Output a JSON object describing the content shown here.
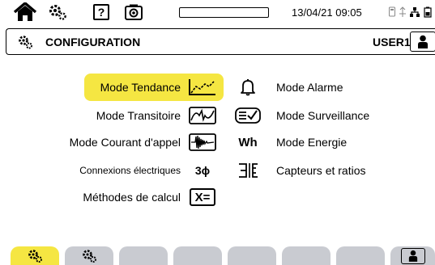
{
  "status_bar": {
    "datetime": "13/04/21 09:05",
    "icons": [
      "home-icon",
      "settings-gear-icon",
      "help-icon",
      "camera-icon",
      "progress-bar",
      "usb-icon",
      "network-icon",
      "battery-icon"
    ]
  },
  "title_bar": {
    "title": "CONFIGURATION",
    "user": "USER1",
    "icon": "configuration-gear-icon",
    "user_icon": "user-icon"
  },
  "menu": {
    "left": [
      {
        "label": "Mode Tendance",
        "icon": "trend-chart-icon",
        "selected": true
      },
      {
        "label": "Mode Transitoire",
        "icon": "transient-wave-icon",
        "selected": false
      },
      {
        "label": "Mode Courant d'appel",
        "icon": "inrush-current-icon",
        "selected": false
      },
      {
        "label": "Connexions électriques",
        "icon": "three-phase-icon",
        "icon_text": "3ϕ",
        "selected": false
      },
      {
        "label": "Méthodes de calcul",
        "icon": "calculation-icon",
        "icon_text": "X=",
        "selected": false
      }
    ],
    "right": [
      {
        "label": "Mode Alarme",
        "icon": "bell-icon"
      },
      {
        "label": "Mode Surveillance",
        "icon": "monitoring-checklist-icon"
      },
      {
        "label": "Mode Energie",
        "icon": "energy-wh-icon",
        "icon_text": "Wh"
      },
      {
        "label": "Capteurs et ratios",
        "icon": "sensor-ratio-icon"
      }
    ]
  },
  "tabs": [
    {
      "icon": "config-gear-icon",
      "active": true
    },
    {
      "icon": "settings-gear-icon",
      "active": false
    },
    {
      "icon": "",
      "active": false
    },
    {
      "icon": "",
      "active": false
    },
    {
      "icon": "",
      "active": false
    },
    {
      "icon": "",
      "active": false
    },
    {
      "icon": "",
      "active": false
    },
    {
      "icon": "user-icon",
      "active": false
    }
  ],
  "colors": {
    "accent": "#f5e642",
    "tab_inactive": "#c9cbd1",
    "text": "#000000"
  }
}
